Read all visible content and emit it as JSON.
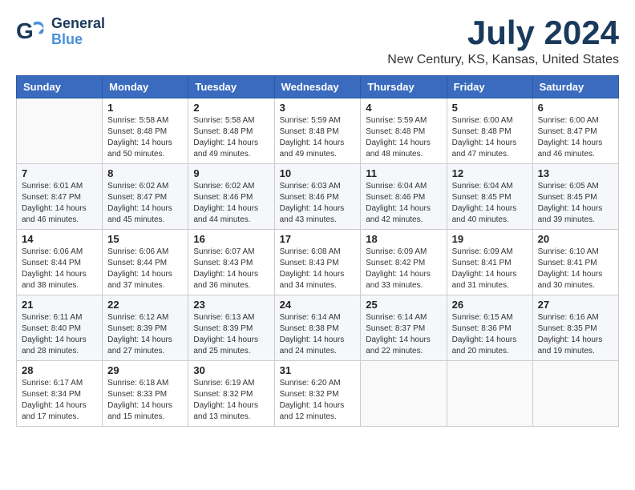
{
  "header": {
    "logo_general": "General",
    "logo_blue": "Blue",
    "month": "July 2024",
    "location": "New Century, KS, Kansas, United States"
  },
  "calendar": {
    "days_of_week": [
      "Sunday",
      "Monday",
      "Tuesday",
      "Wednesday",
      "Thursday",
      "Friday",
      "Saturday"
    ],
    "weeks": [
      [
        {
          "day": "",
          "info": ""
        },
        {
          "day": "1",
          "info": "Sunrise: 5:58 AM\nSunset: 8:48 PM\nDaylight: 14 hours\nand 50 minutes."
        },
        {
          "day": "2",
          "info": "Sunrise: 5:58 AM\nSunset: 8:48 PM\nDaylight: 14 hours\nand 49 minutes."
        },
        {
          "day": "3",
          "info": "Sunrise: 5:59 AM\nSunset: 8:48 PM\nDaylight: 14 hours\nand 49 minutes."
        },
        {
          "day": "4",
          "info": "Sunrise: 5:59 AM\nSunset: 8:48 PM\nDaylight: 14 hours\nand 48 minutes."
        },
        {
          "day": "5",
          "info": "Sunrise: 6:00 AM\nSunset: 8:48 PM\nDaylight: 14 hours\nand 47 minutes."
        },
        {
          "day": "6",
          "info": "Sunrise: 6:00 AM\nSunset: 8:47 PM\nDaylight: 14 hours\nand 46 minutes."
        }
      ],
      [
        {
          "day": "7",
          "info": "Sunrise: 6:01 AM\nSunset: 8:47 PM\nDaylight: 14 hours\nand 46 minutes."
        },
        {
          "day": "8",
          "info": "Sunrise: 6:02 AM\nSunset: 8:47 PM\nDaylight: 14 hours\nand 45 minutes."
        },
        {
          "day": "9",
          "info": "Sunrise: 6:02 AM\nSunset: 8:46 PM\nDaylight: 14 hours\nand 44 minutes."
        },
        {
          "day": "10",
          "info": "Sunrise: 6:03 AM\nSunset: 8:46 PM\nDaylight: 14 hours\nand 43 minutes."
        },
        {
          "day": "11",
          "info": "Sunrise: 6:04 AM\nSunset: 8:46 PM\nDaylight: 14 hours\nand 42 minutes."
        },
        {
          "day": "12",
          "info": "Sunrise: 6:04 AM\nSunset: 8:45 PM\nDaylight: 14 hours\nand 40 minutes."
        },
        {
          "day": "13",
          "info": "Sunrise: 6:05 AM\nSunset: 8:45 PM\nDaylight: 14 hours\nand 39 minutes."
        }
      ],
      [
        {
          "day": "14",
          "info": "Sunrise: 6:06 AM\nSunset: 8:44 PM\nDaylight: 14 hours\nand 38 minutes."
        },
        {
          "day": "15",
          "info": "Sunrise: 6:06 AM\nSunset: 8:44 PM\nDaylight: 14 hours\nand 37 minutes."
        },
        {
          "day": "16",
          "info": "Sunrise: 6:07 AM\nSunset: 8:43 PM\nDaylight: 14 hours\nand 36 minutes."
        },
        {
          "day": "17",
          "info": "Sunrise: 6:08 AM\nSunset: 8:43 PM\nDaylight: 14 hours\nand 34 minutes."
        },
        {
          "day": "18",
          "info": "Sunrise: 6:09 AM\nSunset: 8:42 PM\nDaylight: 14 hours\nand 33 minutes."
        },
        {
          "day": "19",
          "info": "Sunrise: 6:09 AM\nSunset: 8:41 PM\nDaylight: 14 hours\nand 31 minutes."
        },
        {
          "day": "20",
          "info": "Sunrise: 6:10 AM\nSunset: 8:41 PM\nDaylight: 14 hours\nand 30 minutes."
        }
      ],
      [
        {
          "day": "21",
          "info": "Sunrise: 6:11 AM\nSunset: 8:40 PM\nDaylight: 14 hours\nand 28 minutes."
        },
        {
          "day": "22",
          "info": "Sunrise: 6:12 AM\nSunset: 8:39 PM\nDaylight: 14 hours\nand 27 minutes."
        },
        {
          "day": "23",
          "info": "Sunrise: 6:13 AM\nSunset: 8:39 PM\nDaylight: 14 hours\nand 25 minutes."
        },
        {
          "day": "24",
          "info": "Sunrise: 6:14 AM\nSunset: 8:38 PM\nDaylight: 14 hours\nand 24 minutes."
        },
        {
          "day": "25",
          "info": "Sunrise: 6:14 AM\nSunset: 8:37 PM\nDaylight: 14 hours\nand 22 minutes."
        },
        {
          "day": "26",
          "info": "Sunrise: 6:15 AM\nSunset: 8:36 PM\nDaylight: 14 hours\nand 20 minutes."
        },
        {
          "day": "27",
          "info": "Sunrise: 6:16 AM\nSunset: 8:35 PM\nDaylight: 14 hours\nand 19 minutes."
        }
      ],
      [
        {
          "day": "28",
          "info": "Sunrise: 6:17 AM\nSunset: 8:34 PM\nDaylight: 14 hours\nand 17 minutes."
        },
        {
          "day": "29",
          "info": "Sunrise: 6:18 AM\nSunset: 8:33 PM\nDaylight: 14 hours\nand 15 minutes."
        },
        {
          "day": "30",
          "info": "Sunrise: 6:19 AM\nSunset: 8:32 PM\nDaylight: 14 hours\nand 13 minutes."
        },
        {
          "day": "31",
          "info": "Sunrise: 6:20 AM\nSunset: 8:32 PM\nDaylight: 14 hours\nand 12 minutes."
        },
        {
          "day": "",
          "info": ""
        },
        {
          "day": "",
          "info": ""
        },
        {
          "day": "",
          "info": ""
        }
      ]
    ]
  }
}
